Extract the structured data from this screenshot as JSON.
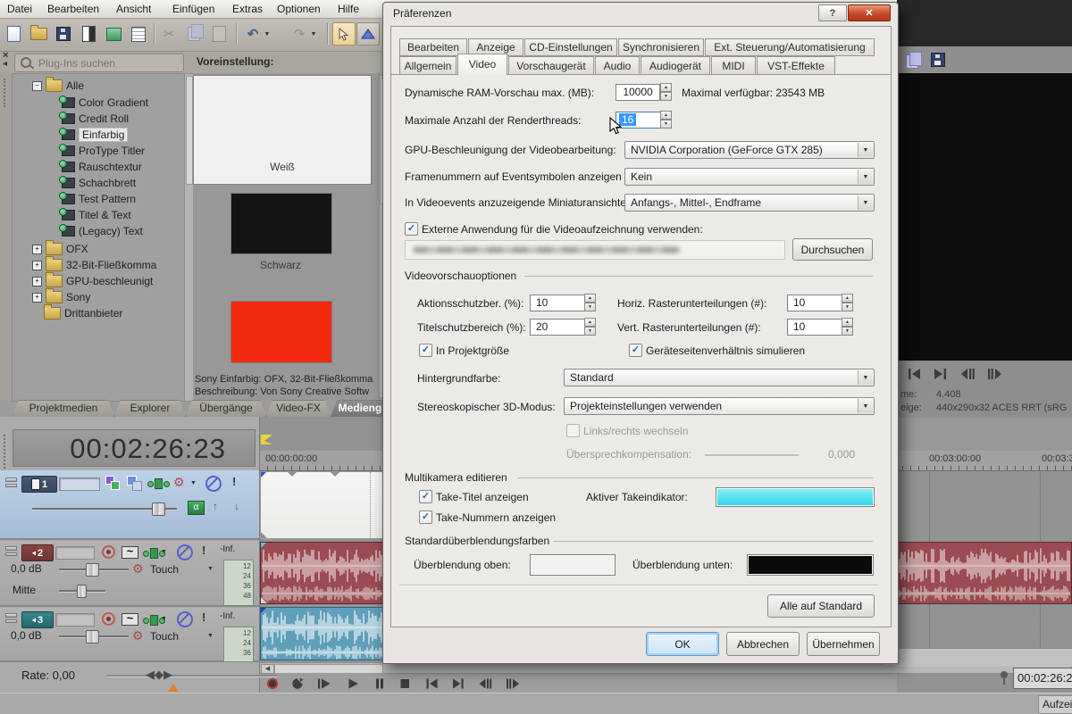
{
  "menubar": {
    "items": [
      "Datei",
      "Bearbeiten",
      "Ansicht",
      "Einfügen",
      "Extras",
      "Optionen",
      "Hilfe"
    ]
  },
  "plugin_panel": {
    "search_placeholder": "Plug-Ins suchen",
    "preset_label": "Voreinstellung:"
  },
  "tree": {
    "root": "Alle",
    "generators": [
      "Color Gradient",
      "Credit Roll",
      "Einfarbig",
      "ProType Titler",
      "Rauschtextur",
      "Schachbrett",
      "Test Pattern",
      "Titel & Text",
      "(Legacy) Text"
    ],
    "selected": "Einfarbig",
    "folders": [
      "OFX",
      "32-Bit-Fließkomma",
      "GPU-beschleunigt",
      "Sony",
      "Drittanbieter"
    ]
  },
  "presets": {
    "white_label": "Weiß",
    "black_label": "Schwarz",
    "info_line1": "Sony Einfarbig: OFX, 32-Bit-Fließkomma",
    "info_line2": "Beschreibung: Von Sony Creative Softw",
    "colors": {
      "white": "#f1f0ee",
      "black": "#141414",
      "red": "#f3290f"
    }
  },
  "dock_tabs": {
    "items": [
      "Projektmedien",
      "Explorer",
      "Übergänge",
      "Video-FX",
      "Medieng"
    ],
    "active": "Medieng"
  },
  "timeline": {
    "timecode": "00:02:26:23",
    "ruler_left": "00:00:00:00",
    "ruler_mid": "00:03:00:00",
    "ruler_right": "00:03:3",
    "rate_label": "Rate: 0,00",
    "scroll_timecode": "00:02:26:2",
    "record_label": "Aufzeich"
  },
  "tracks": {
    "track1": {
      "number": "1"
    },
    "track2": {
      "number": "2",
      "db": "0,0 dB",
      "pan": "Mitte",
      "automation": "Touch",
      "meter_top": "-Inf.",
      "meter_scale": [
        "12",
        "24",
        "36",
        "48"
      ]
    },
    "track3": {
      "number": "3",
      "db": "0,0 dB",
      "automation": "Touch",
      "meter_top": "-Inf.",
      "meter_scale": [
        "12",
        "24",
        "36"
      ]
    }
  },
  "preview": {
    "info_label1": "me:",
    "info_value1": "4.408",
    "info_label2": "eige:",
    "info_value2": "440x290x32 ACES RRT (sRG"
  },
  "dialog": {
    "title": "Präferenzen",
    "tabs_row1": [
      "Bearbeiten",
      "Anzeige",
      "CD-Einstellungen",
      "Synchronisieren",
      "Ext. Steuerung/Automatisierung"
    ],
    "tabs_row2": [
      "Allgemein",
      "Video",
      "Vorschaugerät",
      "Audio",
      "Audiogerät",
      "MIDI",
      "VST-Effekte"
    ],
    "active_tab": "Video",
    "ram_label": "Dynamische RAM-Vorschau max. (MB):",
    "ram_value": "10000",
    "ram_max": "Maximal verfügbar: 23543 MB",
    "threads_label": "Maximale Anzahl der Renderthreads:",
    "threads_value": "16",
    "gpu_label": "GPU-Beschleunigung der Videobearbeitung:",
    "gpu_value": "NVIDIA Corporation (GeForce GTX 285)",
    "framenum_label": "Framenummern auf Eventsymbolen anzeigen als:",
    "framenum_value": "Kein",
    "thumb_label": "In Videoevents anzuzeigende Miniaturansichten:",
    "thumb_value": "Anfangs-, Mittel-, Endframe",
    "extapp_label": "Externe Anwendung für die Videoaufzeichnung verwenden:",
    "browse_button": "Durchsuchen",
    "group_preview": "Videovorschauoptionen",
    "action_label": "Aktionsschutzber. (%):",
    "action_value": "10",
    "title_safe_label": "Titelschutzbereich (%):",
    "title_safe_value": "20",
    "horiz_label": "Horiz. Rasterunterteilungen (#):",
    "horiz_value": "10",
    "vert_label": "Vert. Rasterunterteilungen (#):",
    "vert_value": "10",
    "chk_projsize": "In Projektgröße",
    "chk_aspect": "Geräteseitenverhältnis simulieren",
    "bg_label": "Hintergrundfarbe:",
    "bg_value": "Standard",
    "stereo_label": "Stereoskopischer 3D-Modus:",
    "stereo_value": "Projekteinstellungen verwenden",
    "chk_swap": "Links/rechts wechseln",
    "crosstalk_label": "Übersprechkompensation:",
    "crosstalk_value": "0,000",
    "group_multicam": "Multikamera editieren",
    "chk_take_title": "Take-Titel anzeigen",
    "chk_take_number": "Take-Nummern anzeigen",
    "take_indicator_label": "Aktiver Takeindikator:",
    "take_indicator_color": "#40dff0",
    "group_fade": "Standardüberblendungsfarben",
    "fade_top_label": "Überblendung oben:",
    "fade_top_color": "#f2f2f0",
    "fade_bottom_label": "Überblendung unten:",
    "fade_bottom_color": "#0b0b0b",
    "default_button": "Alle auf Standard",
    "ok": "OK",
    "cancel": "Abbrechen",
    "apply": "Übernehmen"
  },
  "icons": {
    "check": "✓",
    "arrow_down": "▼",
    "spin_up": "▲",
    "spin_down": "▼",
    "undo": "↶",
    "redo": "↷",
    "cut": "✂",
    "gear": "⚙",
    "solo": "!",
    "speaker": "◂",
    "scrub": "◀◆▶",
    "panel_close": "×",
    "panel_collapse": "◂",
    "help": "?",
    "close": "✕",
    "alpha": "α",
    "wave": "~",
    "arrow_up_small": "↑",
    "arrow_down_small": "↓",
    "minus": "−",
    "plus": "+"
  }
}
